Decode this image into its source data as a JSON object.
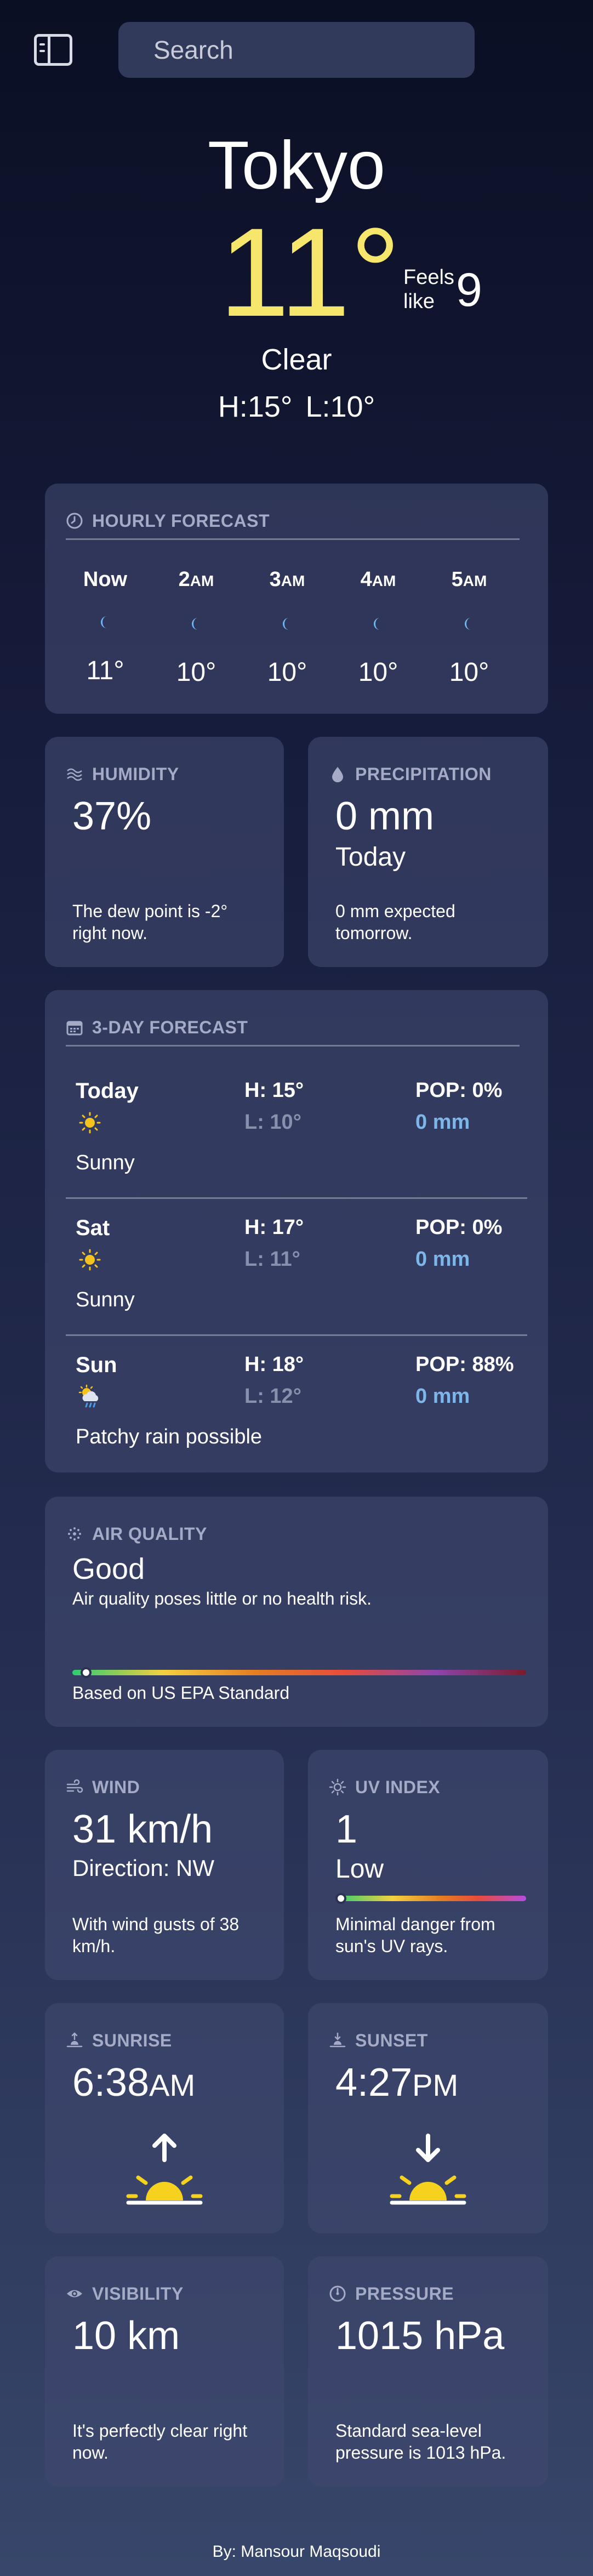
{
  "topbar": {
    "search_placeholder": "Search",
    "sidebar_icon": "sidebar-toggle-icon"
  },
  "current": {
    "city": "Tokyo",
    "temp": "11°",
    "feels_label": "Feels like",
    "feels_value": "9",
    "condition": "Clear",
    "high": "H:15°",
    "low": "L:10°"
  },
  "hourly": {
    "title": "HOURLY FORECAST",
    "icon": "clock-icon",
    "hours": [
      {
        "label": "Now",
        "suffix": "",
        "icon": "moon-icon",
        "temp": "11°"
      },
      {
        "label": "2",
        "suffix": "AM",
        "icon": "moon-icon",
        "temp": "10°"
      },
      {
        "label": "3",
        "suffix": "AM",
        "icon": "moon-icon",
        "temp": "10°"
      },
      {
        "label": "4",
        "suffix": "AM",
        "icon": "moon-icon",
        "temp": "10°"
      },
      {
        "label": "5",
        "suffix": "AM",
        "icon": "moon-icon",
        "temp": "10°"
      }
    ]
  },
  "humidity": {
    "title": "HUMIDITY",
    "icon": "humidity-icon",
    "value": "37%",
    "note": "The dew point is -2° right now."
  },
  "precipitation": {
    "title": "PRECIPITATION",
    "icon": "raindrop-icon",
    "value": "0 mm",
    "sub": "Today",
    "note": "0 mm expected tomorrow."
  },
  "forecast": {
    "title": "3-DAY FORECAST",
    "icon": "calendar-icon",
    "days": [
      {
        "day": "Today",
        "icon": "sun-icon",
        "desc": "Sunny",
        "high": "H: 15°",
        "low": "L: 10°",
        "pop": "POP: 0%",
        "precip": "0 mm"
      },
      {
        "day": "Sat",
        "icon": "sun-icon",
        "desc": "Sunny",
        "high": "H: 17°",
        "low": "L: 11°",
        "pop": "POP: 0%",
        "precip": "0 mm"
      },
      {
        "day": "Sun",
        "icon": "sun-rain-cloud-icon",
        "desc": "Patchy rain possible",
        "high": "H: 18°",
        "low": "L: 12°",
        "pop": "POP: 88%",
        "precip": "0 mm"
      }
    ]
  },
  "air_quality": {
    "title": "AIR QUALITY",
    "icon": "air-quality-icon",
    "value": "Good",
    "desc": "Air quality poses little or no health risk.",
    "note": "Based on US EPA Standard",
    "level_fraction": 0.03
  },
  "wind": {
    "title": "WIND",
    "icon": "wind-icon",
    "value": "31 km/h",
    "direction": "Direction: NW",
    "note": "With wind gusts of 38 km/h."
  },
  "uv": {
    "title": "UV INDEX",
    "icon": "uv-sun-icon",
    "value": "1",
    "level": "Low",
    "note": "Minimal danger from sun's UV rays.",
    "level_fraction": 0.03
  },
  "sunrise": {
    "title": "SUNRISE",
    "icon": "sunrise-icon",
    "time": "6:38",
    "period": "AM"
  },
  "sunset": {
    "title": "SUNSET",
    "icon": "sunset-icon",
    "time": "4:27",
    "period": "PM"
  },
  "visibility": {
    "title": "VISIBILITY",
    "icon": "eye-icon",
    "value": "10 km",
    "note": "It's perfectly clear right now."
  },
  "pressure": {
    "title": "PRESSURE",
    "icon": "gauge-icon",
    "value": "1015 hPa",
    "note": "Standard sea-level pressure is 1013 hPa."
  },
  "footer": {
    "credit": "By: Mansour Maqsoudi"
  },
  "colors": {
    "temp_accent": "#f6e76c",
    "card_bg": "#3d456a",
    "muted": "#a5abc6",
    "precip_blue": "#7fb6ea",
    "sun_yellow": "#f6d21e"
  }
}
